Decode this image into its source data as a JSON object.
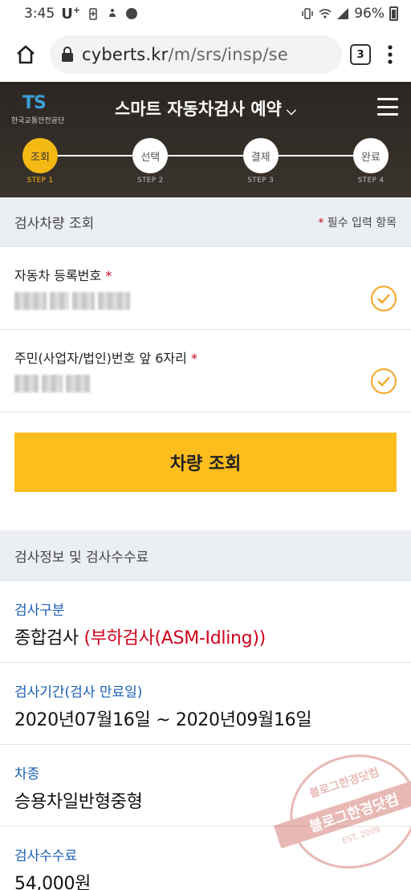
{
  "status_bar": {
    "time": "3:45",
    "carrier": "U",
    "carrier_sup": "+",
    "battery_pct": "96%"
  },
  "browser": {
    "url_domain": "cyberts.kr",
    "url_path": "/m/srs/insp/se",
    "tab_count": "3"
  },
  "header": {
    "logo_text_t": "T",
    "logo_text_s": "S",
    "logo_org": "한국교통안전공단",
    "title": "스마트 자동차검사 예약",
    "title_chevron": "⌵"
  },
  "steps": [
    {
      "label": "조회",
      "sub": "STEP 1",
      "active": true
    },
    {
      "label": "선택",
      "sub": "STEP 2",
      "active": false
    },
    {
      "label": "결제",
      "sub": "STEP 3",
      "active": false
    },
    {
      "label": "완료",
      "sub": "STEP 4",
      "active": false
    }
  ],
  "lookup_section": {
    "title": "검사차량 조회",
    "required_star": "*",
    "required_note": " 필수 입력 항목"
  },
  "fields": [
    {
      "label": "자동차 등록번호",
      "star": "*"
    },
    {
      "label": "주민(사업자/법인)번호 앞 6자리",
      "star": "*"
    }
  ],
  "lookup_button": "차량 조회",
  "info_section": {
    "title": "검사정보 및 검사수수료"
  },
  "info": [
    {
      "key": "검사구분",
      "value": "종합검사",
      "sub": "(부하검사(ASM-Idling))"
    },
    {
      "key": "검사기간(검사 만료일)",
      "value": "2020년07월16일 ~ 2020년09월16일",
      "sub": ""
    },
    {
      "key": "차종",
      "value": "승용차일반형중형",
      "sub": ""
    },
    {
      "key": "검사수수료",
      "value": "54,000원",
      "sub": ""
    }
  ],
  "watermark": {
    "top": "블로그한경닷컴",
    "band": "블로그한경닷컴",
    "bottom": "EST. 2009"
  },
  "colors": {
    "accent_yellow": "#fdbd1c",
    "step_active": "#f5b914",
    "link_blue": "#1a5fb4",
    "required_red": "#d0021b"
  }
}
